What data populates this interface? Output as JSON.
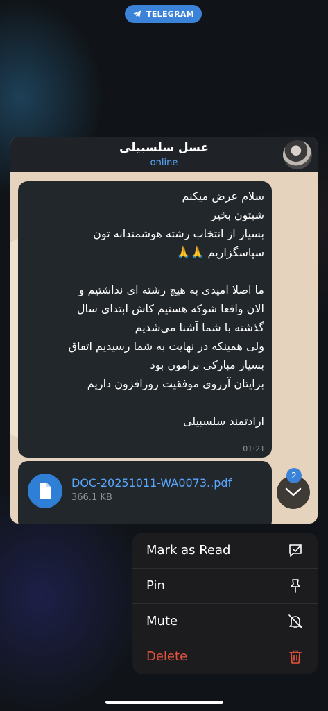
{
  "app_banner": {
    "label": "TELEGRAM",
    "icon": "telegram-icon"
  },
  "chat": {
    "title": "عسل سلسبیلی",
    "status": "online",
    "avatar": "avatar-photo"
  },
  "message": {
    "text": "سلام عرض میکنم\nشبتون بخیر\nبسیار از انتخاب رشته هوشمندانه تون\nسپاسگزاریم 🙏🙏\n\nما اصلا امیدی به هیچ رشته ای نداشتیم و\nالان واقعا شوکه هستیم کاش ابتدای سال\nگذشته با شما آشنا می‌شدیم\nولی همینکه در نهایت به شما رسیدیم اتفاق\nبسیار مبارکی برامون بود\nبرایتان آرزوی موفقیت روزافزون داریم\n\nارادتمند سلسبیلی",
    "time": "01:21"
  },
  "file_message": {
    "name": "DOC-20251011-WA0073..pdf",
    "size": "366.1 KB"
  },
  "scroll_button": {
    "badge": "2",
    "icon": "chevron-down-icon"
  },
  "context_menu": {
    "items": [
      {
        "label": "Mark as Read",
        "icon": "mark-read-icon",
        "danger": false
      },
      {
        "label": "Pin",
        "icon": "pin-icon",
        "danger": false
      },
      {
        "label": "Mute",
        "icon": "bell-off-icon",
        "danger": false
      },
      {
        "label": "Delete",
        "icon": "trash-icon",
        "danger": true
      }
    ]
  },
  "colors": {
    "accent": "#3b82d9",
    "link": "#5aa7ff",
    "danger": "#e5533f",
    "menu_bg": "#1c1c1e",
    "bubble_bg": "#22272b"
  }
}
